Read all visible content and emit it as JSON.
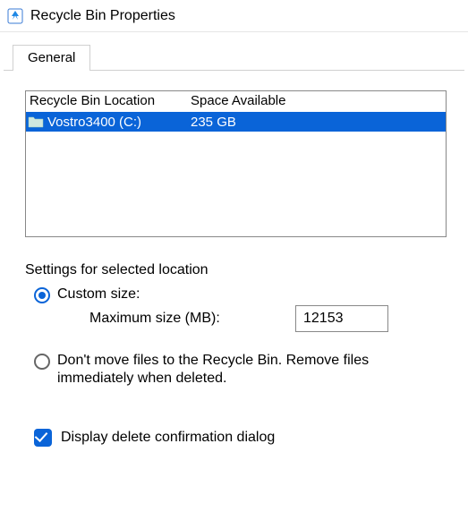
{
  "window": {
    "title": "Recycle Bin Properties"
  },
  "tabs": {
    "general": "General"
  },
  "list": {
    "header_location": "Recycle Bin Location",
    "header_space": "Space Available",
    "rows": [
      {
        "location": "Vostro3400 (C:)",
        "space": "235 GB"
      }
    ]
  },
  "settings": {
    "title": "Settings for selected location",
    "custom_size_label": "Custom size:",
    "max_size_label": "Maximum size (MB):",
    "max_size_value": "12153",
    "dont_move_label": "Don't move files to the Recycle Bin. Remove files immediately when deleted.",
    "confirm_label": "Display delete confirmation dialog"
  }
}
